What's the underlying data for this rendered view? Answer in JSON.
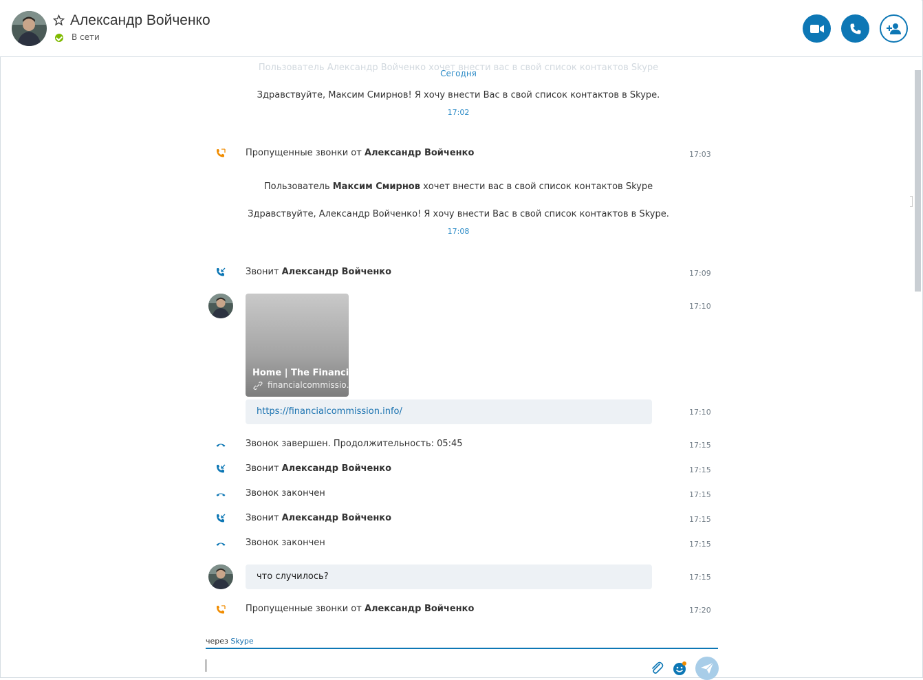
{
  "header": {
    "contact_name": "Александр Войченко",
    "status": "В сети",
    "buttons": [
      "video-call",
      "audio-call",
      "add-to-contacts"
    ]
  },
  "colors": {
    "accent": "#0d77b5",
    "missed_call": "#f08c00",
    "online": "#7fba00"
  },
  "chat": {
    "ghost_text": "Пользователь Александр Войченко хочет внести вас в свой список контактов Skype",
    "date_separator": "Сегодня",
    "request1": {
      "text": "Здравствуйте, Максим Смирнов! Я хочу внести Вас в свой список контактов в Skype.",
      "time": "17:02"
    },
    "missed1": {
      "prefix": "Пропущенные звонки от ",
      "name": "Александр Войченко",
      "time": "17:03"
    },
    "user_request": {
      "prefix": "Пользователь ",
      "name": "Максим Смирнов",
      "suffix": " хочет внести вас в свой список контактов Skype"
    },
    "request2": {
      "text": "Здравствуйте, Александр Войченко! Я хочу внести Вас в свой список контактов в Skype.",
      "time": "17:08"
    },
    "incoming1": {
      "prefix": "Звонит ",
      "name": "Александр Войченко",
      "time": "17:09"
    },
    "link_card": {
      "title": "Home | The Financi…",
      "domain": "financialcommissio…",
      "time": "17:10"
    },
    "link_message": {
      "url": "https://financialcommission.info/",
      "time": "17:10"
    },
    "call_ended1": {
      "text": "Звонок завершен. Продолжительность: 05:45",
      "time": "17:15"
    },
    "incoming2": {
      "prefix": "Звонит ",
      "name": "Александр Войченко",
      "time": "17:15"
    },
    "ended2": {
      "text": "Звонок закончен",
      "time": "17:15"
    },
    "incoming3": {
      "prefix": "Звонит ",
      "name": "Александр Войченко",
      "time": "17:15"
    },
    "ended3": {
      "text": "Звонок закончен",
      "time": "17:15"
    },
    "message": {
      "text": "что случилось?",
      "time": "17:15"
    },
    "missed2": {
      "prefix": "Пропущенные звонки от ",
      "name": "Александр Войченко",
      "time": "17:20"
    }
  },
  "composer": {
    "via_prefix": "через ",
    "via_app": "Skype"
  }
}
